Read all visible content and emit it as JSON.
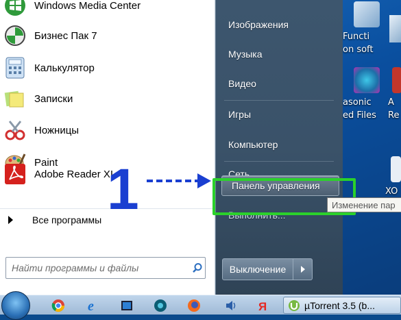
{
  "start_menu": {
    "programs": [
      {
        "label": "Windows Media Center",
        "icon": "windows-media-center-icon"
      },
      {
        "label": "Бизнес Пак 7",
        "icon": "business-pack-icon"
      },
      {
        "label": "Калькулятор",
        "icon": "calculator-icon"
      },
      {
        "label": "Записки",
        "icon": "sticky-notes-icon"
      },
      {
        "label": "Ножницы",
        "icon": "scissors-icon"
      },
      {
        "label": "Paint",
        "icon": "paint-palette-icon"
      },
      {
        "label": "Adobe Reader XI",
        "icon": "adobe-reader-icon"
      }
    ],
    "all_programs_label": "Все программы",
    "search_placeholder": "Найти программы и файлы",
    "right_links": [
      {
        "label": "Изображения"
      },
      {
        "label": "Музыка"
      },
      {
        "label": "Видео"
      },
      {
        "label": "Игры"
      },
      {
        "label": "Компьютер"
      },
      {
        "label": "Сеть"
      },
      {
        "label": "Панель управления"
      },
      {
        "label": "Выполнить..."
      }
    ],
    "shutdown_label": "Выключение"
  },
  "annotation": {
    "number": "1",
    "color": "#1a3fd1",
    "frame_color": "#2bd12b"
  },
  "tooltip": {
    "text": "Изменение пар"
  },
  "desktop_icons": [
    {
      "lines": [
        "Functi",
        "on soft"
      ]
    },
    {
      "lines": [
        "asonic",
        "ed Files"
      ]
    },
    {
      "lines": [
        "A",
        "Re"
      ]
    },
    {
      "lines": [
        "XO"
      ]
    }
  ],
  "taskbar": {
    "apps": [
      "chrome-icon",
      "internet-explorer-icon",
      "media-player-icon",
      "media-app-icon",
      "firefox-icon",
      "volume-icon",
      "yandex-icon"
    ],
    "active_window": "µTorrent 3.5 (b..."
  }
}
